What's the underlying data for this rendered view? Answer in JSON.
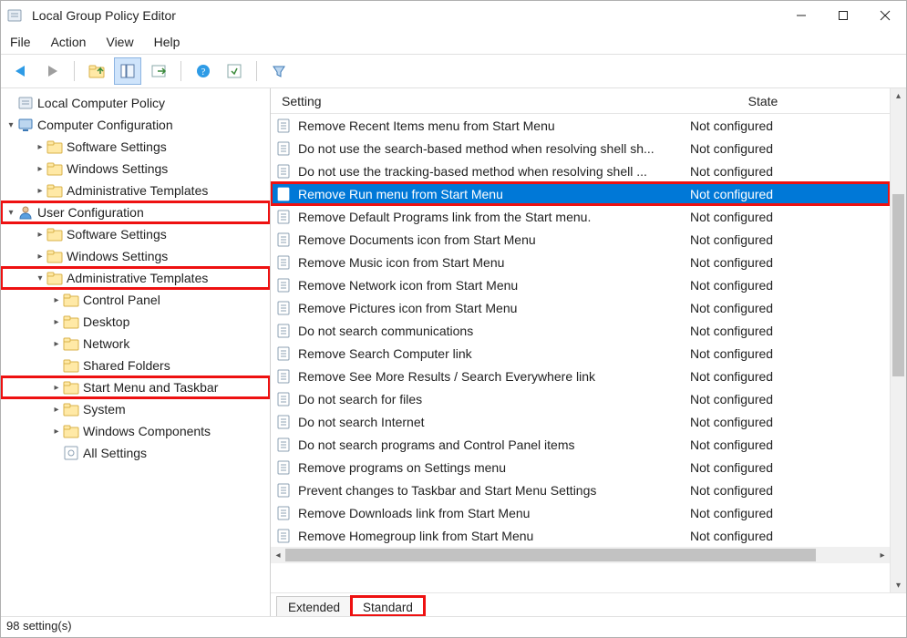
{
  "window": {
    "title": "Local Group Policy Editor"
  },
  "menu": [
    "File",
    "Action",
    "View",
    "Help"
  ],
  "tree": {
    "root": "Local Computer Policy",
    "cc": "Computer Configuration",
    "cc_items": [
      "Software Settings",
      "Windows Settings",
      "Administrative Templates"
    ],
    "uc": "User Configuration",
    "uc_items": [
      "Software Settings",
      "Windows Settings"
    ],
    "admin": "Administrative Templates",
    "admin_items": [
      "Control Panel",
      "Desktop",
      "Network",
      "Shared Folders",
      "Start Menu and Taskbar",
      "System",
      "Windows Components",
      "All Settings"
    ]
  },
  "columns": {
    "setting": "Setting",
    "state": "State"
  },
  "rows": [
    {
      "name": "Remove Recent Items menu from Start Menu",
      "state": "Not configured",
      "sel": false
    },
    {
      "name": "Do not use the search-based method when resolving shell sh...",
      "state": "Not configured",
      "sel": false
    },
    {
      "name": "Do not use the tracking-based method when resolving shell ...",
      "state": "Not configured",
      "sel": false
    },
    {
      "name": "Remove Run menu from Start Menu",
      "state": "Not configured",
      "sel": true
    },
    {
      "name": "Remove Default Programs link from the Start menu.",
      "state": "Not configured",
      "sel": false
    },
    {
      "name": "Remove Documents icon from Start Menu",
      "state": "Not configured",
      "sel": false
    },
    {
      "name": "Remove Music icon from Start Menu",
      "state": "Not configured",
      "sel": false
    },
    {
      "name": "Remove Network icon from Start Menu",
      "state": "Not configured",
      "sel": false
    },
    {
      "name": "Remove Pictures icon from Start Menu",
      "state": "Not configured",
      "sel": false
    },
    {
      "name": "Do not search communications",
      "state": "Not configured",
      "sel": false
    },
    {
      "name": "Remove Search Computer link",
      "state": "Not configured",
      "sel": false
    },
    {
      "name": "Remove See More Results / Search Everywhere link",
      "state": "Not configured",
      "sel": false
    },
    {
      "name": "Do not search for files",
      "state": "Not configured",
      "sel": false
    },
    {
      "name": "Do not search Internet",
      "state": "Not configured",
      "sel": false
    },
    {
      "name": "Do not search programs and Control Panel items",
      "state": "Not configured",
      "sel": false
    },
    {
      "name": "Remove programs on Settings menu",
      "state": "Not configured",
      "sel": false
    },
    {
      "name": "Prevent changes to Taskbar and Start Menu Settings",
      "state": "Not configured",
      "sel": false
    },
    {
      "name": "Remove Downloads link from Start Menu",
      "state": "Not configured",
      "sel": false
    },
    {
      "name": "Remove Homegroup link from Start Menu",
      "state": "Not configured",
      "sel": false
    }
  ],
  "tabs": {
    "extended": "Extended",
    "standard": "Standard"
  },
  "status": "98 setting(s)"
}
